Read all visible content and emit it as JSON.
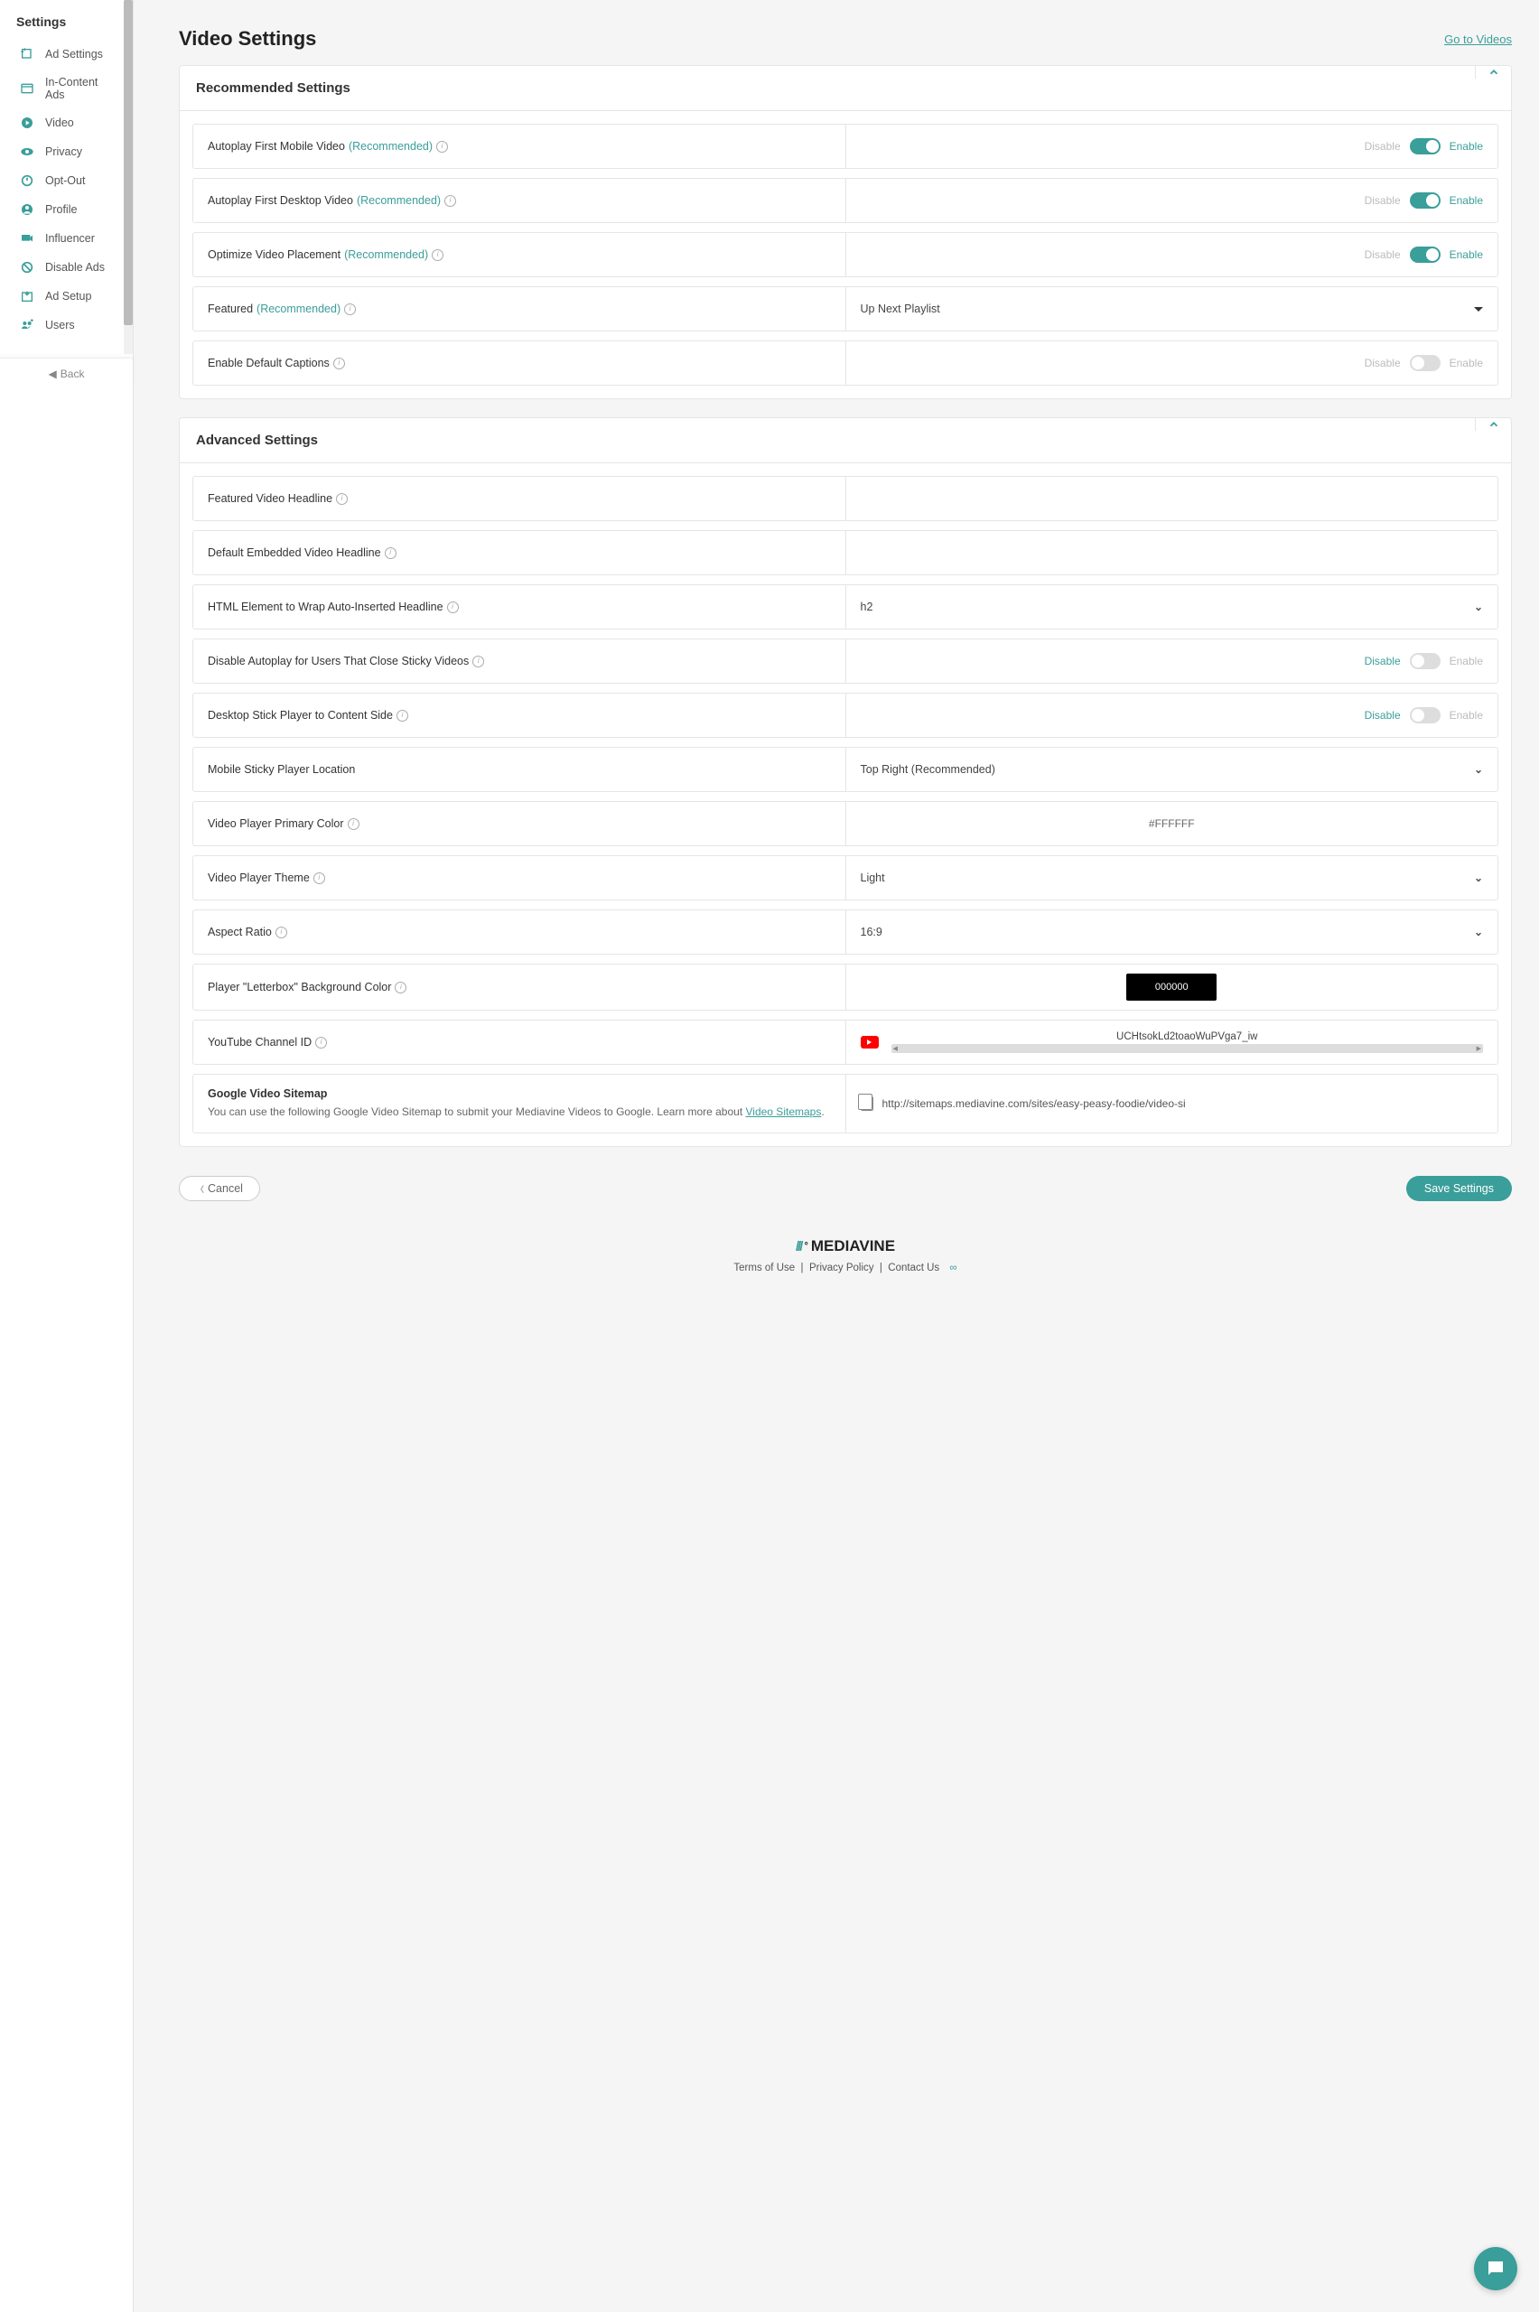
{
  "sidebar": {
    "title": "Settings",
    "items": [
      {
        "label": "Ad Settings",
        "icon": "ad-settings"
      },
      {
        "label": "In-Content Ads",
        "icon": "in-content"
      },
      {
        "label": "Video",
        "icon": "video"
      },
      {
        "label": "Privacy",
        "icon": "privacy"
      },
      {
        "label": "Opt-Out",
        "icon": "opt-out"
      },
      {
        "label": "Profile",
        "icon": "profile"
      },
      {
        "label": "Influencer",
        "icon": "influencer"
      },
      {
        "label": "Disable Ads",
        "icon": "disable-ads"
      },
      {
        "label": "Ad Setup",
        "icon": "ad-setup"
      },
      {
        "label": "Users",
        "icon": "users"
      }
    ],
    "back_label": "Back"
  },
  "header": {
    "title": "Video Settings",
    "link": "Go to Videos"
  },
  "recommended": {
    "title": "Recommended Settings",
    "rows": {
      "autoplay_mobile": {
        "label": "Autoplay First Mobile Video",
        "rec": "(Recommended)",
        "disable": "Disable",
        "enable": "Enable"
      },
      "autoplay_desktop": {
        "label": "Autoplay First Desktop Video",
        "rec": "(Recommended)",
        "disable": "Disable",
        "enable": "Enable"
      },
      "optimize_placement": {
        "label": "Optimize Video Placement",
        "rec": "(Recommended)",
        "disable": "Disable",
        "enable": "Enable"
      },
      "featured": {
        "label": "Featured",
        "rec": "(Recommended)",
        "value": "Up Next Playlist"
      },
      "default_captions": {
        "label": "Enable Default Captions",
        "disable": "Disable",
        "enable": "Enable"
      }
    }
  },
  "advanced": {
    "title": "Advanced Settings",
    "rows": {
      "featured_headline": {
        "label": "Featured Video Headline",
        "value": ""
      },
      "default_embedded_headline": {
        "label": "Default Embedded Video Headline",
        "value": ""
      },
      "html_element_wrap": {
        "label": "HTML Element to Wrap Auto-Inserted Headline",
        "value": "h2"
      },
      "disable_autoplay_close": {
        "label": "Disable Autoplay for Users That Close Sticky Videos",
        "disable": "Disable",
        "enable": "Enable"
      },
      "desktop_stick_content": {
        "label": "Desktop Stick Player to Content Side",
        "disable": "Disable",
        "enable": "Enable"
      },
      "mobile_sticky_location": {
        "label": "Mobile Sticky Player Location",
        "value": "Top Right (Recommended)"
      },
      "primary_color": {
        "label": "Video Player Primary Color",
        "value": "#FFFFFF"
      },
      "theme": {
        "label": "Video Player Theme",
        "value": "Light"
      },
      "aspect_ratio": {
        "label": "Aspect Ratio",
        "value": "16:9"
      },
      "letterbox": {
        "label": "Player \"Letterbox\" Background Color",
        "value": "000000"
      },
      "youtube_channel": {
        "label": "YouTube Channel ID",
        "value": "UCHtsokLd2toaoWuPVga7_iw"
      },
      "sitemap": {
        "title": "Google Video Sitemap",
        "desc_prefix": "You can use the following Google Video Sitemap to submit your Mediavine Videos to Google. Learn more about ",
        "link_text": "Video Sitemaps",
        "desc_suffix": ".",
        "url": "http://sitemaps.mediavine.com/sites/easy-peasy-foodie/video-si"
      }
    }
  },
  "actions": {
    "cancel": "Cancel",
    "save": "Save Settings"
  },
  "footer": {
    "logo": "MEDIAVINE",
    "terms": "Terms of Use",
    "privacy": "Privacy Policy",
    "contact": "Contact Us"
  }
}
